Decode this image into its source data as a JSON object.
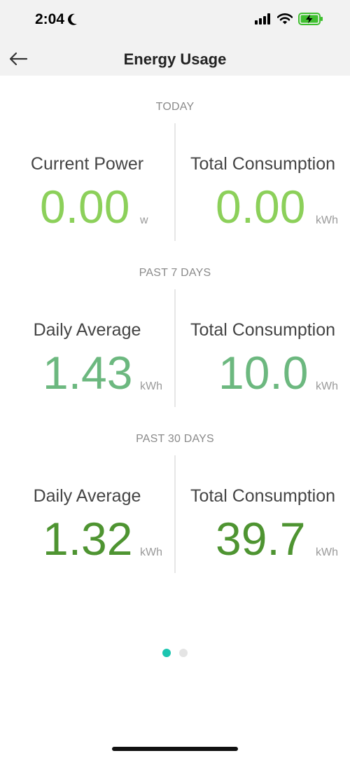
{
  "status_bar": {
    "time": "2:04"
  },
  "nav": {
    "title": "Energy Usage"
  },
  "colors": {
    "today": "#8cd05a",
    "past7": "#6cb87f",
    "past30": "#4e9431",
    "dot_active": "#1cc5b0",
    "dot_inactive": "#e4e4e4"
  },
  "sections": [
    {
      "label": "TODAY",
      "left": {
        "label": "Current Power",
        "value": "0.00",
        "unit": "w"
      },
      "right": {
        "label": "Total Consumption",
        "value": "0.00",
        "unit": "kWh"
      }
    },
    {
      "label": "PAST 7 DAYS",
      "left": {
        "label": "Daily Average",
        "value": "1.43",
        "unit": "kWh"
      },
      "right": {
        "label": "Total Consumption",
        "value": "10.0",
        "unit": "kWh"
      }
    },
    {
      "label": "PAST 30 DAYS",
      "left": {
        "label": "Daily Average",
        "value": "1.32",
        "unit": "kWh"
      },
      "right": {
        "label": "Total Consumption",
        "value": "39.7",
        "unit": "kWh"
      }
    }
  ],
  "pager": {
    "pages": 2,
    "current": 1
  }
}
